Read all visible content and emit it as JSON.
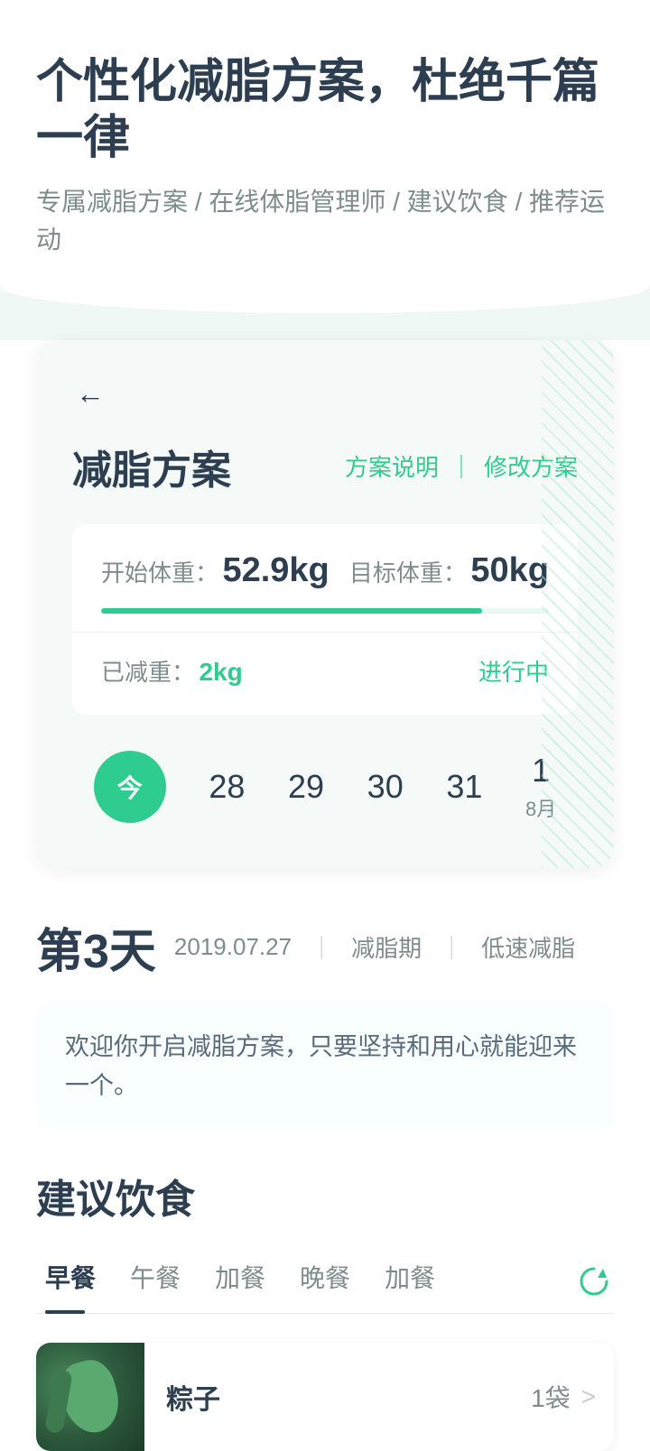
{
  "header": {
    "title": "个性化减脂方案，杜绝千篇一律",
    "subtitle": "专属减脂方案 / 在线体脂管理师 / 建议饮食 / 推荐运动"
  },
  "card": {
    "back_label": "←",
    "title": "减脂方案",
    "action_explain": "方案说明",
    "action_divider": "｜",
    "action_modify": "修改方案",
    "weight_start_label": "开始体重：",
    "weight_start_value": "52.9kg",
    "weight_target_label": "目标体重：",
    "weight_target_value": "50kg",
    "lost_label": "已减重：",
    "lost_value": "2kg",
    "status": "进行中",
    "progress_percent": 85
  },
  "calendar": {
    "today_label": "今",
    "days": [
      "28",
      "29",
      "30",
      "31"
    ],
    "next_day": "1",
    "next_month": "8月"
  },
  "day_info": {
    "day_number": "第3天",
    "date": "2019.07.27",
    "pipe1": "｜",
    "tag1": "减脂期",
    "pipe2": "｜",
    "tag2": "低速减脂",
    "welcome": "欢迎你开启减脂方案，只要坚持和用心就能迎来一个。"
  },
  "diet": {
    "title": "建议饮食",
    "tabs": [
      {
        "label": "早餐",
        "active": true
      },
      {
        "label": "午餐",
        "active": false
      },
      {
        "label": "加餐",
        "active": false
      },
      {
        "label": "晚餐",
        "active": false
      },
      {
        "label": "加餐",
        "active": false
      }
    ],
    "refresh_label": "刷新",
    "food_item": {
      "name": "粽子",
      "amount": "1袋",
      "arrow": ">"
    }
  }
}
